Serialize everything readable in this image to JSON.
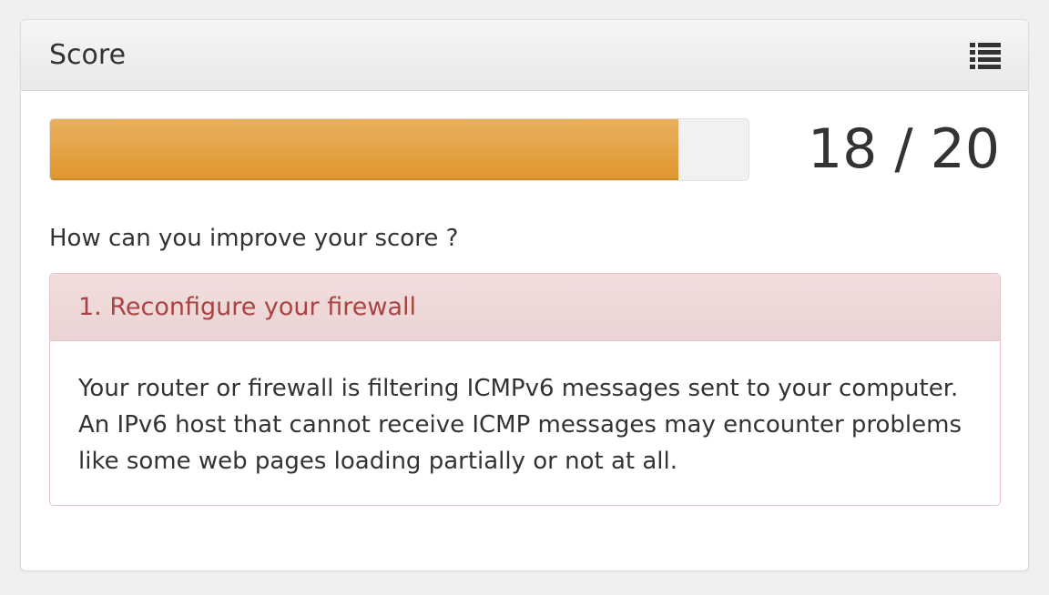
{
  "panel": {
    "title": "Score",
    "menu_icon": "list-icon"
  },
  "score": {
    "value": 18,
    "max": 20,
    "display": "18 / 20",
    "progress_fraction": 0.9,
    "bar_color": "#e0972f"
  },
  "improve": {
    "question": "How can you improve your score ?"
  },
  "advice": [
    {
      "title": "1. Reconfigure your firewall",
      "body": "Your router or firewall is filtering ICMPv6 messages sent to your computer. An IPv6 host that cannot receive ICMP messages may encounter problems like some web pages loading partially or not at all."
    }
  ],
  "colors": {
    "warning_text": "#a94442",
    "warning_bg": "#f2dede"
  }
}
